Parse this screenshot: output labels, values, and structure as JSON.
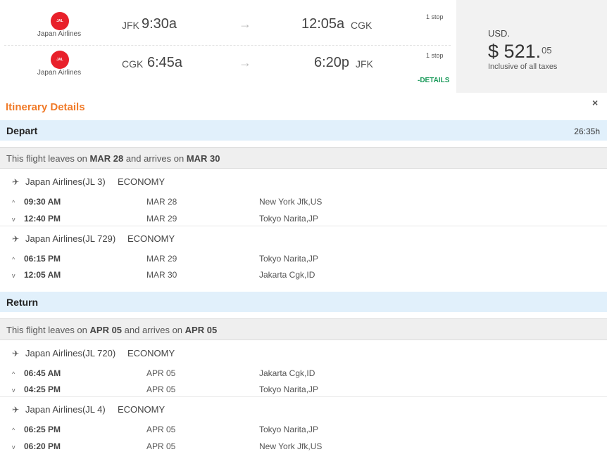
{
  "summary": {
    "outbound": {
      "airline": "Japan Airlines",
      "logo_text": "JAL",
      "from_code": "JFK",
      "dep_time": "9:30a",
      "arr_time": "12:05a",
      "to_code": "CGK",
      "stops": "1 stop"
    },
    "inbound": {
      "airline": "Japan Airlines",
      "logo_text": "JAL",
      "from_code": "CGK",
      "dep_time": "6:45a",
      "arr_time": "6:20p",
      "to_code": "JFK",
      "stops": "1 stop"
    },
    "arrow": "→",
    "details_link": "-DETAILS"
  },
  "price": {
    "currency": "USD.",
    "symbol": "$",
    "amount": "521.",
    "cents": "05",
    "note": "Inclusive of all taxes"
  },
  "itinerary": {
    "title": "Itinerary Details",
    "close": "×",
    "depart": {
      "label": "Depart",
      "duration": "26:35h",
      "leaves_prefix": "This flight leaves on ",
      "leaves_date": "MAR 28",
      "arrives_mid": " and arrives on ",
      "arrives_date": "MAR 30",
      "segments": [
        {
          "flight": "Japan Airlines(JL 3)",
          "cabin": "ECONOMY",
          "dep": {
            "time": "09:30 AM",
            "date": "MAR 28",
            "place": "New York Jfk,US"
          },
          "arr": {
            "time": "12:40 PM",
            "date": "MAR 29",
            "place": "Tokyo Narita,JP"
          }
        },
        {
          "flight": "Japan Airlines(JL 729)",
          "cabin": "ECONOMY",
          "dep": {
            "time": "06:15 PM",
            "date": "MAR 29",
            "place": "Tokyo Narita,JP"
          },
          "arr": {
            "time": "12:05 AM",
            "date": "MAR 30",
            "place": "Jakarta Cgk,ID"
          }
        }
      ]
    },
    "return": {
      "label": "Return",
      "leaves_prefix": "This flight leaves on ",
      "leaves_date": "APR 05",
      "arrives_mid": " and arrives on ",
      "arrives_date": "APR 05",
      "segments": [
        {
          "flight": "Japan Airlines(JL 720)",
          "cabin": "ECONOMY",
          "dep": {
            "time": "06:45 AM",
            "date": "APR 05",
            "place": "Jakarta Cgk,ID"
          },
          "arr": {
            "time": "04:25 PM",
            "date": "APR 05",
            "place": "Tokyo Narita,JP"
          }
        },
        {
          "flight": "Japan Airlines(JL 4)",
          "cabin": "ECONOMY",
          "dep": {
            "time": "06:25 PM",
            "date": "APR 05",
            "place": "Tokyo Narita,JP"
          },
          "arr": {
            "time": "06:20 PM",
            "date": "APR 05",
            "place": "New York Jfk,US"
          }
        }
      ]
    }
  },
  "icons": {
    "plane": "✈",
    "chevron_up": "^",
    "chevron_down": "v"
  },
  "colors": {
    "accent": "#f07a28",
    "airline_red": "#e8202a",
    "details_green": "#1a9a5a",
    "section_blue": "#e1f0fb"
  }
}
